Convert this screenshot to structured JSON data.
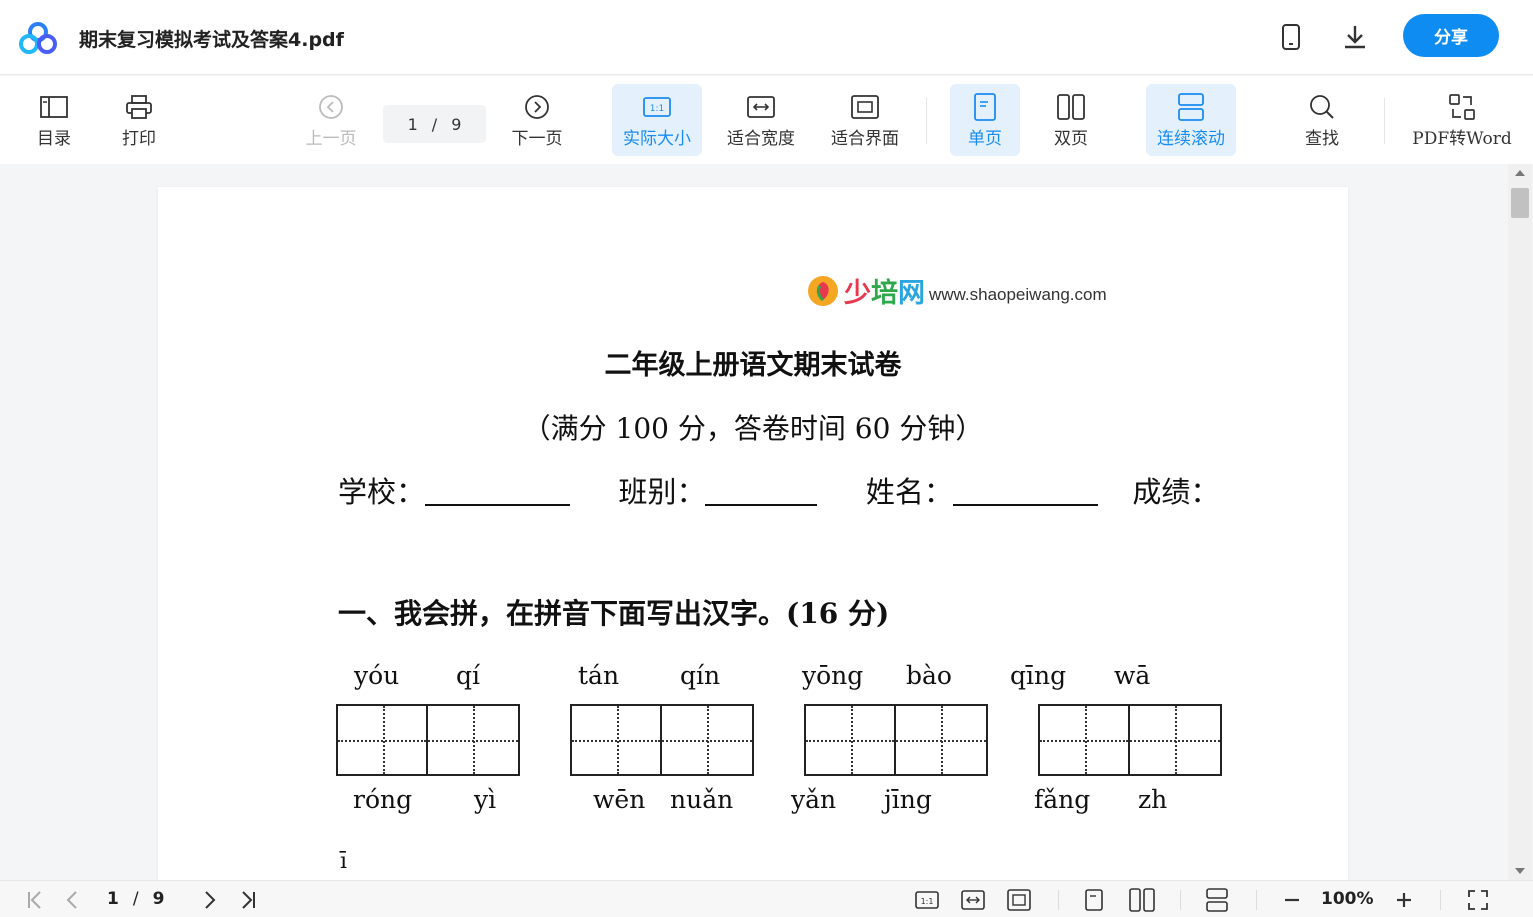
{
  "header": {
    "title": "期末复习模拟考试及答案4.pdf",
    "share_label": "分享",
    "brand_color": "#0e8cf1"
  },
  "toolbar": {
    "toc_label": "目录",
    "print_label": "打印",
    "prev_label": "上一页",
    "current_page": "1",
    "page_sep": "/",
    "total_pages": "9",
    "next_label": "下一页",
    "actual_size_label": "实际大小",
    "fit_width_label": "适合宽度",
    "fit_page_label": "适合界面",
    "single_page_label": "单页",
    "double_page_label": "双页",
    "continuous_label": "连续滚动",
    "search_label": "查找",
    "pdf2word_label": "PDF转Word"
  },
  "document": {
    "brand_name": "少培网",
    "brand_url": "www.shaopeiwang.com",
    "title": "二年级上册语文期末试卷",
    "subtitle": "（满分 100 分，答卷时间 60 分钟）",
    "school_label": "学校：",
    "class_label": "班别：",
    "name_label": "姓名：",
    "score_label": "成绩：",
    "section1": "一、我会拼，在拼音下面写出汉字。(16 分)",
    "pinyin_top": [
      "yóu",
      "qí",
      "tán",
      "qín",
      "yōng",
      "bào",
      "qīng",
      "wā"
    ],
    "pinyin_bottom": [
      "róng",
      "yì",
      "wēn",
      "nuǎn",
      "yǎn",
      "jīng",
      "fǎng",
      "zh"
    ],
    "stray_char": "ī"
  },
  "statusbar": {
    "current_page": "1",
    "page_sep": "/",
    "total_pages": "9",
    "zoom": "100%"
  }
}
